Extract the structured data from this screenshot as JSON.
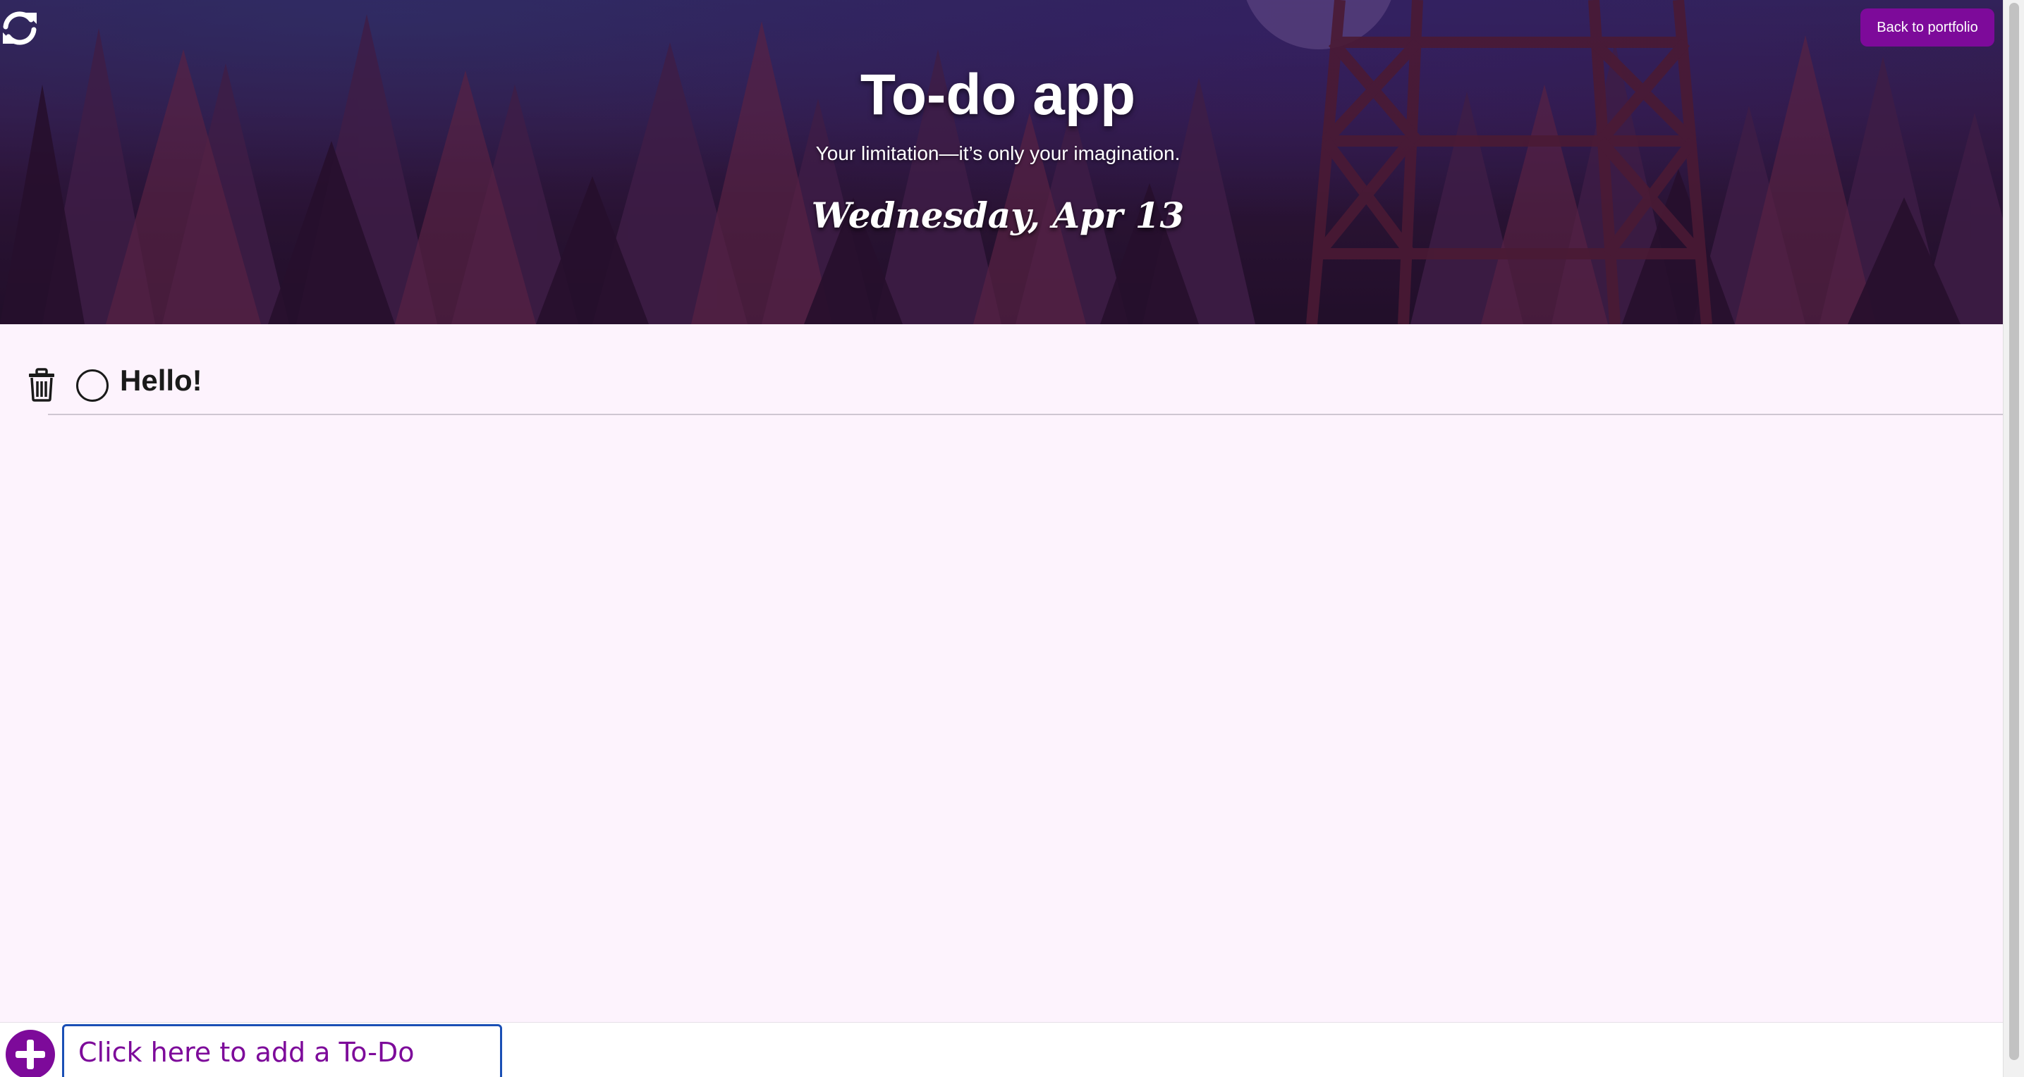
{
  "hero": {
    "title": "To-do app",
    "subtitle": "Your limitation—it’s only your imagination.",
    "date": "Wednesday, Apr 13",
    "back_button_label": "Back to portfolio",
    "refresh_icon": "refresh-icon"
  },
  "todos": [
    {
      "text": "Hello!",
      "completed": false
    }
  ],
  "add_todo": {
    "placeholder": "Click here to add a To-Do",
    "add_icon": "plus-circle-icon"
  },
  "colors": {
    "accent": "#7d0a9a",
    "page_background": "#fdf3fd",
    "input_border": "#1a4fb5"
  }
}
